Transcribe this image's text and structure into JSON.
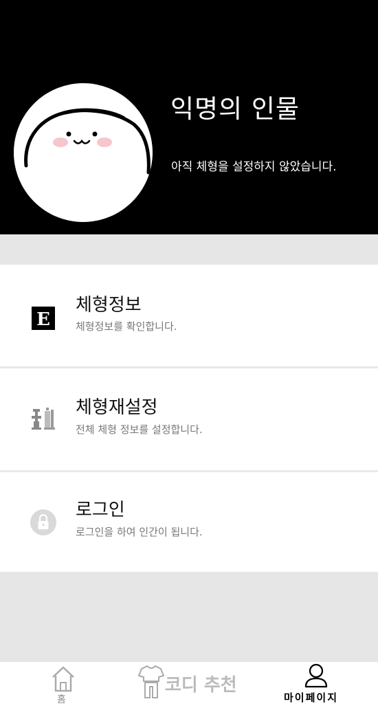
{
  "profile": {
    "name": "익명의 인물",
    "status": "아직 체형을 설정하지 않았습니다."
  },
  "menu": [
    {
      "title": "체형정보",
      "description": "체형정보를 확인합니다.",
      "icon": "e-badge-icon"
    },
    {
      "title": "체형재설정",
      "description": "전체 체형 정보를 설정합니다.",
      "icon": "body-figures-icon"
    },
    {
      "title": "로그인",
      "description": "로그인을 하여 인간이 됩니다.",
      "icon": "lock-icon"
    }
  ],
  "tabs": {
    "home": {
      "label": "홈",
      "icon": "home-icon"
    },
    "recommend": {
      "label": "코디 추천",
      "icon": "clothes-icon"
    },
    "mypage": {
      "label": "마이페이지",
      "icon": "person-icon"
    }
  },
  "icon_badge_letter": "E",
  "colors": {
    "header_bg": "#000000",
    "page_bg": "#e6e6e6",
    "text_primary": "#111111",
    "text_secondary": "#777777"
  }
}
